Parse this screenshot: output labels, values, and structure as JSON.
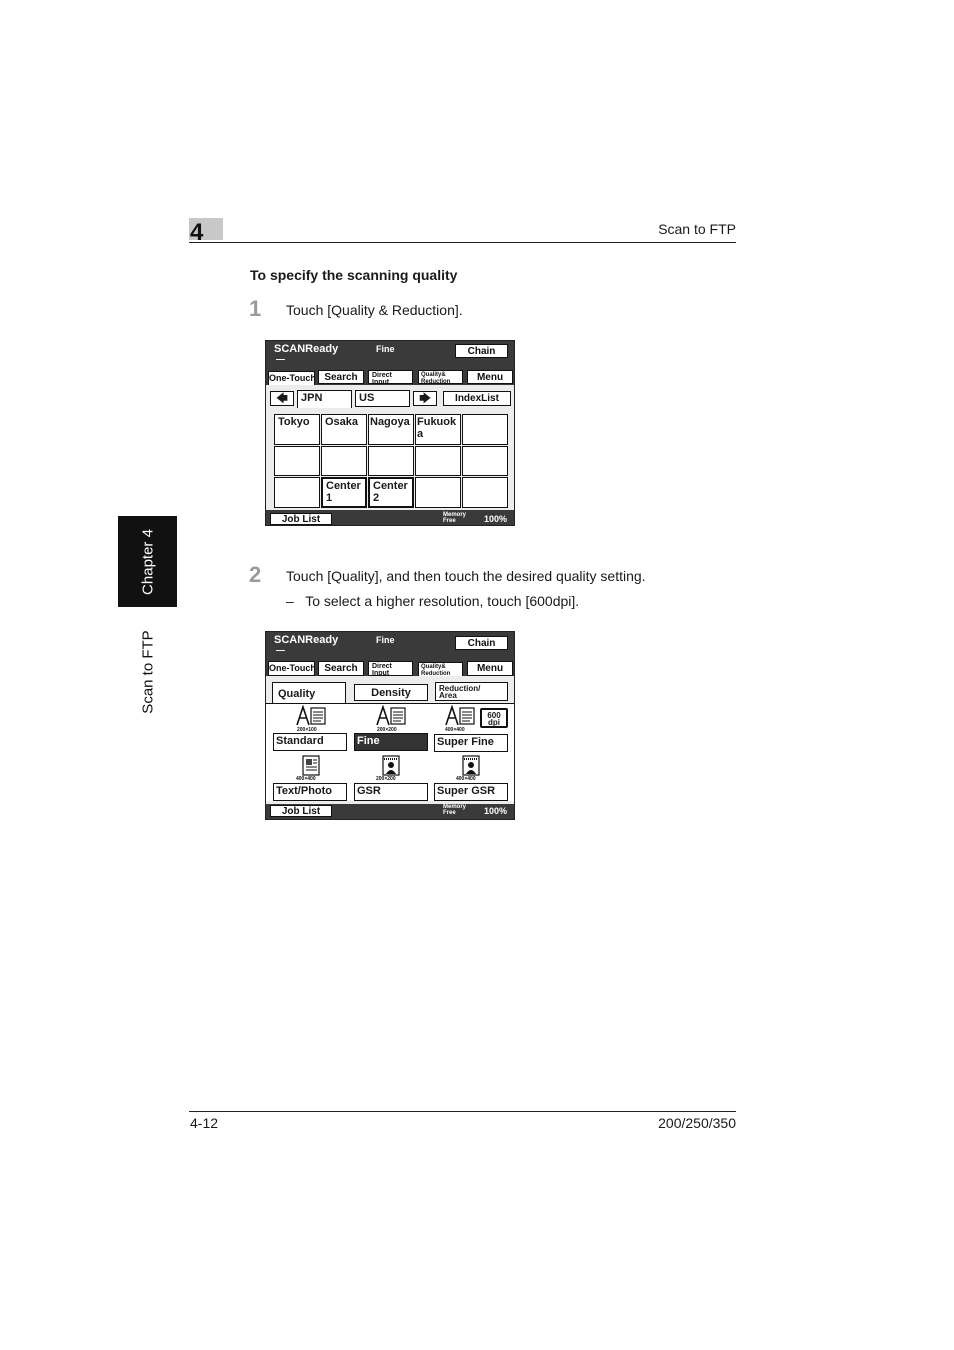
{
  "header": {
    "chapter_number": "4",
    "section_title": "Scan to FTP"
  },
  "side_tab": {
    "chapter_label": "Chapter 4",
    "section_label": "Scan to FTP"
  },
  "section": {
    "title": "To specify the scanning quality"
  },
  "steps": [
    {
      "number": "1",
      "text": "Touch [Quality & Reduction]."
    },
    {
      "number": "2",
      "text": "Touch [Quality], and then touch the desired quality setting.",
      "sub": "–   To select a higher resolution, touch [600dpi]."
    }
  ],
  "panel1": {
    "status": "SCANReady",
    "status_sub": "—",
    "quality": "Fine",
    "chain": "Chain",
    "tabs": {
      "one_touch": "One-Touch",
      "search": "Search",
      "direct_input": "Direct\nInput",
      "quality_reduction": "Quality&\nReduction",
      "menu": "Menu"
    },
    "left_arrow": "🡄",
    "right_arrow": "🡆",
    "index_tabs": [
      "JPN",
      "US"
    ],
    "index_list": "IndexList",
    "cells": [
      "Tokyo",
      "Osaka",
      "Nagoya",
      "Fukuok\na",
      "",
      "",
      "",
      "",
      "",
      "",
      "",
      "Center\n1",
      "Center\n2",
      "",
      ""
    ],
    "job_list": "Job List",
    "memory": "Memory\nFree",
    "memory_value": "100%"
  },
  "panel2": {
    "status": "SCANReady",
    "status_sub": "—",
    "quality": "Fine",
    "chain": "Chain",
    "tabs": {
      "one_touch": "One-Touch",
      "search": "Search",
      "direct_input": "Direct\nInput",
      "quality_reduction": "Quality&\nReduction",
      "menu": "Menu"
    },
    "sub_tabs": {
      "quality": "Quality",
      "density": "Density",
      "reduction": "Reduction/\nArea"
    },
    "dpi_600": "600\ndpi",
    "options": [
      {
        "label": "Standard",
        "dpi": "200×100",
        "selected": false
      },
      {
        "label": "Fine",
        "dpi": "200×200",
        "selected": true
      },
      {
        "label": "Super Fine",
        "dpi": "400×400",
        "selected": false
      },
      {
        "label": "Text/Photo",
        "dpi": "400×400",
        "selected": false
      },
      {
        "label": "GSR",
        "dpi": "200×200",
        "selected": false
      },
      {
        "label": "Super GSR",
        "dpi": "400×400",
        "selected": false
      }
    ],
    "job_list": "Job List",
    "memory": "Memory\nFree",
    "memory_value": "100%"
  },
  "footer": {
    "page": "4-12",
    "models": "200/250/350"
  }
}
